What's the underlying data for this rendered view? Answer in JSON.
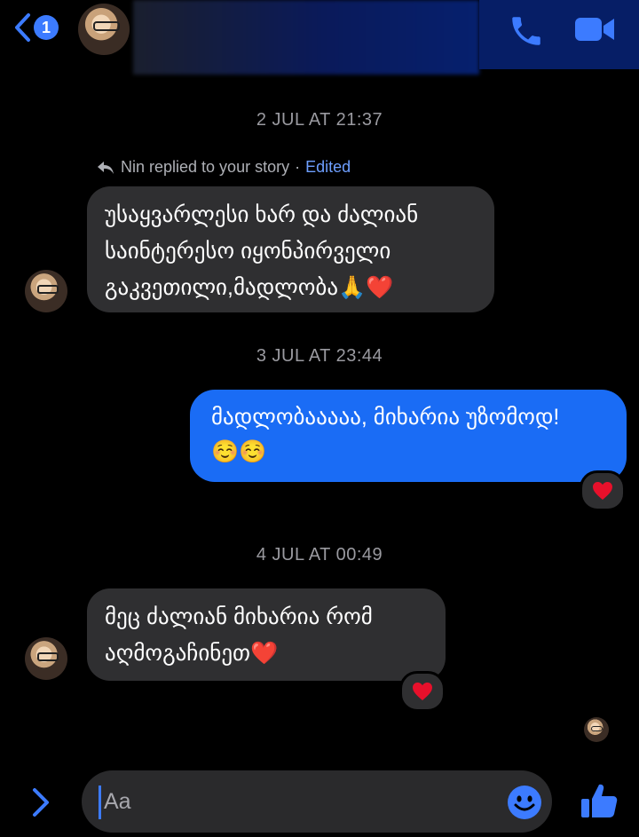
{
  "header": {
    "back_badge": "1",
    "contact_name": ""
  },
  "messages": {
    "ts1": "2 JUL AT 21:37",
    "reply_note": "Nin replied to your story",
    "reply_sep": "·",
    "reply_edited": "Edited",
    "msg1": [
      "უსაყვარლესი ხარ და ძალიან",
      "საინტერესო იყონპირველი",
      "გაკვეთილი,მადლობა🙏❤️"
    ],
    "ts2": "3 JUL AT 23:44",
    "msg2": [
      "მადლობააააა, მიხარია უზომოდ!",
      "☺️☺️"
    ],
    "ts3": "4 JUL AT 00:49",
    "msg3": [
      "მეც ძალიან მიხარია რომ",
      "აღმოგაჩინეთ❤️"
    ]
  },
  "composer": {
    "placeholder": "Aa"
  },
  "colors": {
    "accent": "#1a6cf5",
    "incoming_bubble": "#2f2f31",
    "timestamp": "#9a9aa0",
    "heart": "#e8102b"
  },
  "icons": [
    "back-chevron-icon",
    "phone-icon",
    "video-camera-icon",
    "reply-arrow-icon",
    "heart-icon",
    "expand-chevron-icon",
    "emoji-icon",
    "thumbs-up-icon"
  ]
}
